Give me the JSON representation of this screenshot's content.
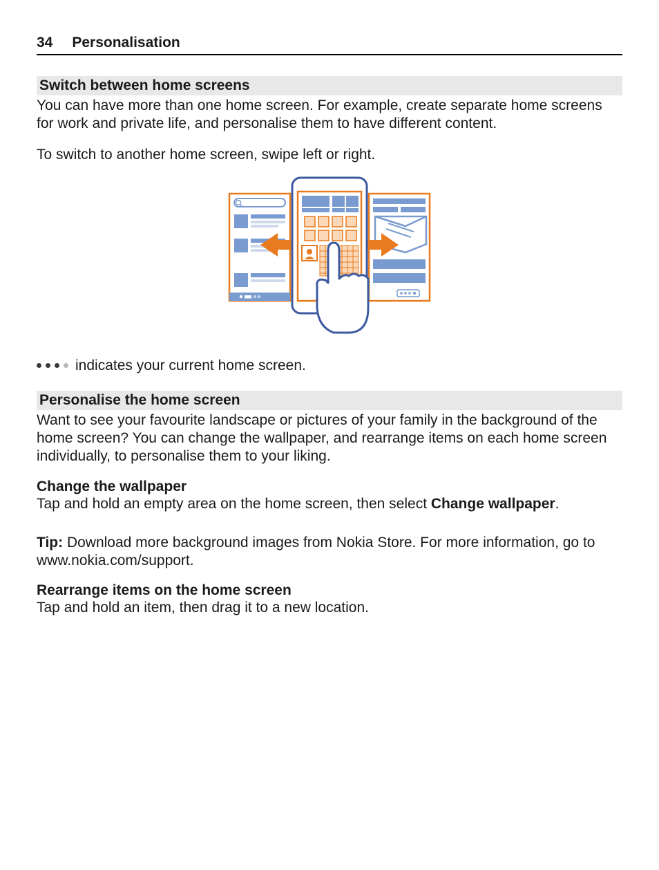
{
  "header": {
    "page_number": "34",
    "chapter": "Personalisation"
  },
  "section1": {
    "title": "Switch between home screens",
    "p1": "You can have more than one home screen. For example, create separate home screens for work and private life, and personalise them to have different content.",
    "p2": "To switch to another home screen, swipe left or right.",
    "indicator_text": "indicates your current home screen."
  },
  "section2": {
    "title": "Personalise the home screen",
    "p1": "Want to see your favourite landscape or pictures of your family in the background of the home screen? You can change the wallpaper, and rearrange items on each home screen individually, to personalise them to your liking.",
    "sub1_title": "Change the wallpaper",
    "sub1_text_a": "Tap and hold an empty area on the home screen, then select ",
    "sub1_text_bold": "Change wallpaper",
    "sub1_text_b": ".",
    "tip_label": "Tip:",
    "tip_text": " Download more background images from Nokia Store. For more information, go to www.nokia.com/support.",
    "sub2_title": "Rearrange items on the home screen",
    "sub2_text": "Tap and hold an item, then drag it to a new location."
  },
  "colors": {
    "accent": "#e87b1f",
    "blue": "#7a9bd0"
  }
}
